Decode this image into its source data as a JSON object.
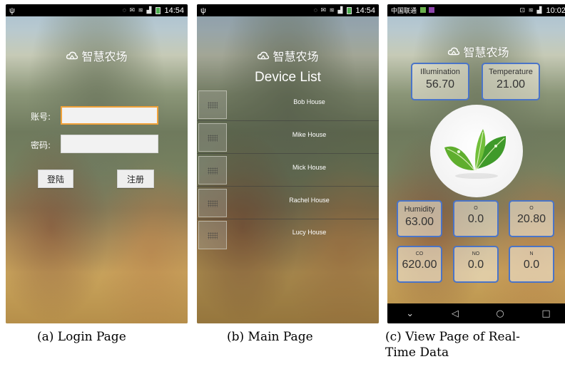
{
  "figure": {
    "captions": {
      "a": "(a) Login Page",
      "b": "(b) Main Page",
      "c_line1": "(c) View Page of Real-",
      "c_line2": "Time Data"
    }
  },
  "login_page": {
    "status_bar": {
      "left_icon": "ψ",
      "icons": "◌ ✉ ≋ ▟",
      "time": "14:54"
    },
    "app_title": "智慧农场",
    "logo_icon": "cloud-farm-icon",
    "account_label": "账号:",
    "account_value": "",
    "password_label": "密码:",
    "password_value": "",
    "login_button": "登陆",
    "register_button": "注册"
  },
  "main_page": {
    "status_bar": {
      "left_icon": "ψ",
      "icons": "◌ ✉ ≋ ▟",
      "time": "14:54"
    },
    "title": "Device List",
    "devices": [
      {
        "name": "Bob House"
      },
      {
        "name": "Mike House"
      },
      {
        "name": "Mick House"
      },
      {
        "name": "Rachel House"
      },
      {
        "name": "Lucy House"
      }
    ]
  },
  "data_page": {
    "status_bar": {
      "carrier": "中国联通",
      "icons": "⊡ ≋ ▟",
      "time": "10:02"
    },
    "app_title": "智慧农场",
    "logo_icon": "cloud-farm-icon",
    "illumination": {
      "label": "Illumination",
      "value": "56.70"
    },
    "temperature": {
      "label": "Temperature",
      "value": "21.00"
    },
    "humidity": {
      "label": "Humidity",
      "value": "63.00"
    },
    "o1": {
      "label": "O",
      "value": "0.0"
    },
    "o2": {
      "label": "O",
      "value": "20.80"
    },
    "co2": {
      "label": "CO",
      "value": "620.00"
    },
    "no2": {
      "label": "NO",
      "value": "0.0"
    },
    "n2": {
      "label": "N",
      "value": "0.0"
    },
    "nav": {
      "back": "◁",
      "home": "○",
      "recent": "□",
      "down": "⌄"
    }
  },
  "colors": {
    "box_border": "#4a74c8",
    "focus_border": "#f0a23a",
    "leaf_green": "#3f9a2a"
  }
}
